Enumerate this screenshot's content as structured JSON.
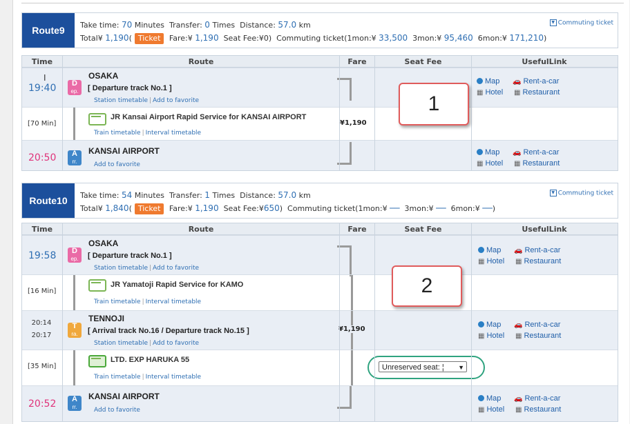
{
  "route9": {
    "badge": "Route9",
    "line1": {
      "take_label": "Take time:",
      "take_value": "70",
      "take_unit": "Minutes",
      "transfer_label": "Transfer:",
      "transfer_value": "0",
      "transfer_unit": "Times",
      "distance_label": "Distance:",
      "distance_value": "57.0",
      "distance_unit": "km"
    },
    "line2": {
      "total_label": "Total¥",
      "total_value": "1,190",
      "total_open": "(",
      "ticket": "Ticket",
      "fare_label": "Fare:¥",
      "fare_value": "1,190",
      "seat_label": "Seat Fee:¥",
      "seat_value": "0",
      "seat_close": ")",
      "commuting_label": "Commuting ticket(1mon:¥",
      "c1": "33,500",
      "c3_label": "3mon:¥",
      "c3": "95,460",
      "c6_label": "6mon:¥",
      "c6": "171,210",
      "close": ")"
    },
    "commuting_link": "Commuting ticket",
    "rows": {
      "dep_time": "19:40",
      "dep_station": "OSAKA",
      "dep_track": "[ Departure track No.1 ]",
      "dep_links": [
        "Station timetable",
        "Add to favorite"
      ],
      "seg_minutes": "[70 Min]",
      "seg_line": "JR Kansai Airport Rapid Service  for KANSAI AIRPORT",
      "seg_links": [
        "Train timetable",
        "Interval timetable"
      ],
      "fare": "¥1,190",
      "arr_time": "20:50",
      "arr_station": "KANSAI AIRPORT",
      "arr_links": [
        "Add to favorite"
      ]
    }
  },
  "route10": {
    "badge": "Route10",
    "line1": {
      "take_label": "Take time:",
      "take_value": "54",
      "take_unit": "Minutes",
      "transfer_label": "Transfer:",
      "transfer_value": "1",
      "transfer_unit": "Times",
      "distance_label": "Distance:",
      "distance_value": "57.0",
      "distance_unit": "km"
    },
    "line2": {
      "total_label": "Total¥",
      "total_value": "1,840",
      "total_open": "(",
      "ticket": "Ticket",
      "fare_label": "Fare:¥",
      "fare_value": "1,190",
      "seat_label": "Seat Fee:¥",
      "seat_value": "650",
      "seat_close": ")",
      "commuting_label": "Commuting ticket(1mon:¥",
      "c1": "──",
      "c3_label": "3mon:¥",
      "c3": "──",
      "c6_label": "6mon:¥",
      "c6": "──",
      "close": ")"
    },
    "commuting_link": "Commuting ticket",
    "rows": {
      "dep_time": "19:58",
      "dep_station": "OSAKA",
      "dep_track": "[ Departure track No.1 ]",
      "dep_links": [
        "Station timetable",
        "Add to favorite"
      ],
      "seg1_minutes": "[16 Min]",
      "seg1_line": "JR Yamatoji Rapid Service  for KAMO",
      "seg1_links": [
        "Train timetable",
        "Interval timetable"
      ],
      "tra_time_arr": "20:14",
      "tra_time_dep": "20:17",
      "tra_station": "TENNOJI",
      "tra_track": "[ Arrival track No.16 / Departure track No.15 ]",
      "tra_links": [
        "Station timetable",
        "Add to favorite"
      ],
      "fare": "¥1,190",
      "seg2_minutes": "[35 Min]",
      "seg2_line": "LTD. EXP HARUKA 55",
      "seg2_links": [
        "Train timetable",
        "Interval timetable"
      ],
      "seat_select": "Unreserved seat: ¦",
      "arr_time": "20:52",
      "arr_station": "KANSAI AIRPORT",
      "arr_links": [
        "Add to favorite"
      ]
    }
  },
  "table_headers": {
    "time": "Time",
    "route": "Route",
    "fare": "Fare",
    "seat_fee": "Seat Fee",
    "useful_link": "UsefulLink"
  },
  "station_icons": {
    "dep_main": "D",
    "dep_sub": "ep.",
    "arr_main": "A",
    "arr_sub": "rr.",
    "tra_main": "T",
    "tra_sub": "ra."
  },
  "useful_links": {
    "map": "Map",
    "rent": "Rent-a-car",
    "hotel": "Hotel",
    "restaurant": "Restaurant"
  },
  "callouts": {
    "one": "1",
    "two": "2"
  },
  "colors": {
    "route_badge": "#1c4f9c",
    "ticket": "#ef7a2f",
    "link": "#2f6fb3",
    "arrival_time": "#e0337a",
    "callout_border": "#e05b5b",
    "highlight_ring": "#2fa37f"
  }
}
